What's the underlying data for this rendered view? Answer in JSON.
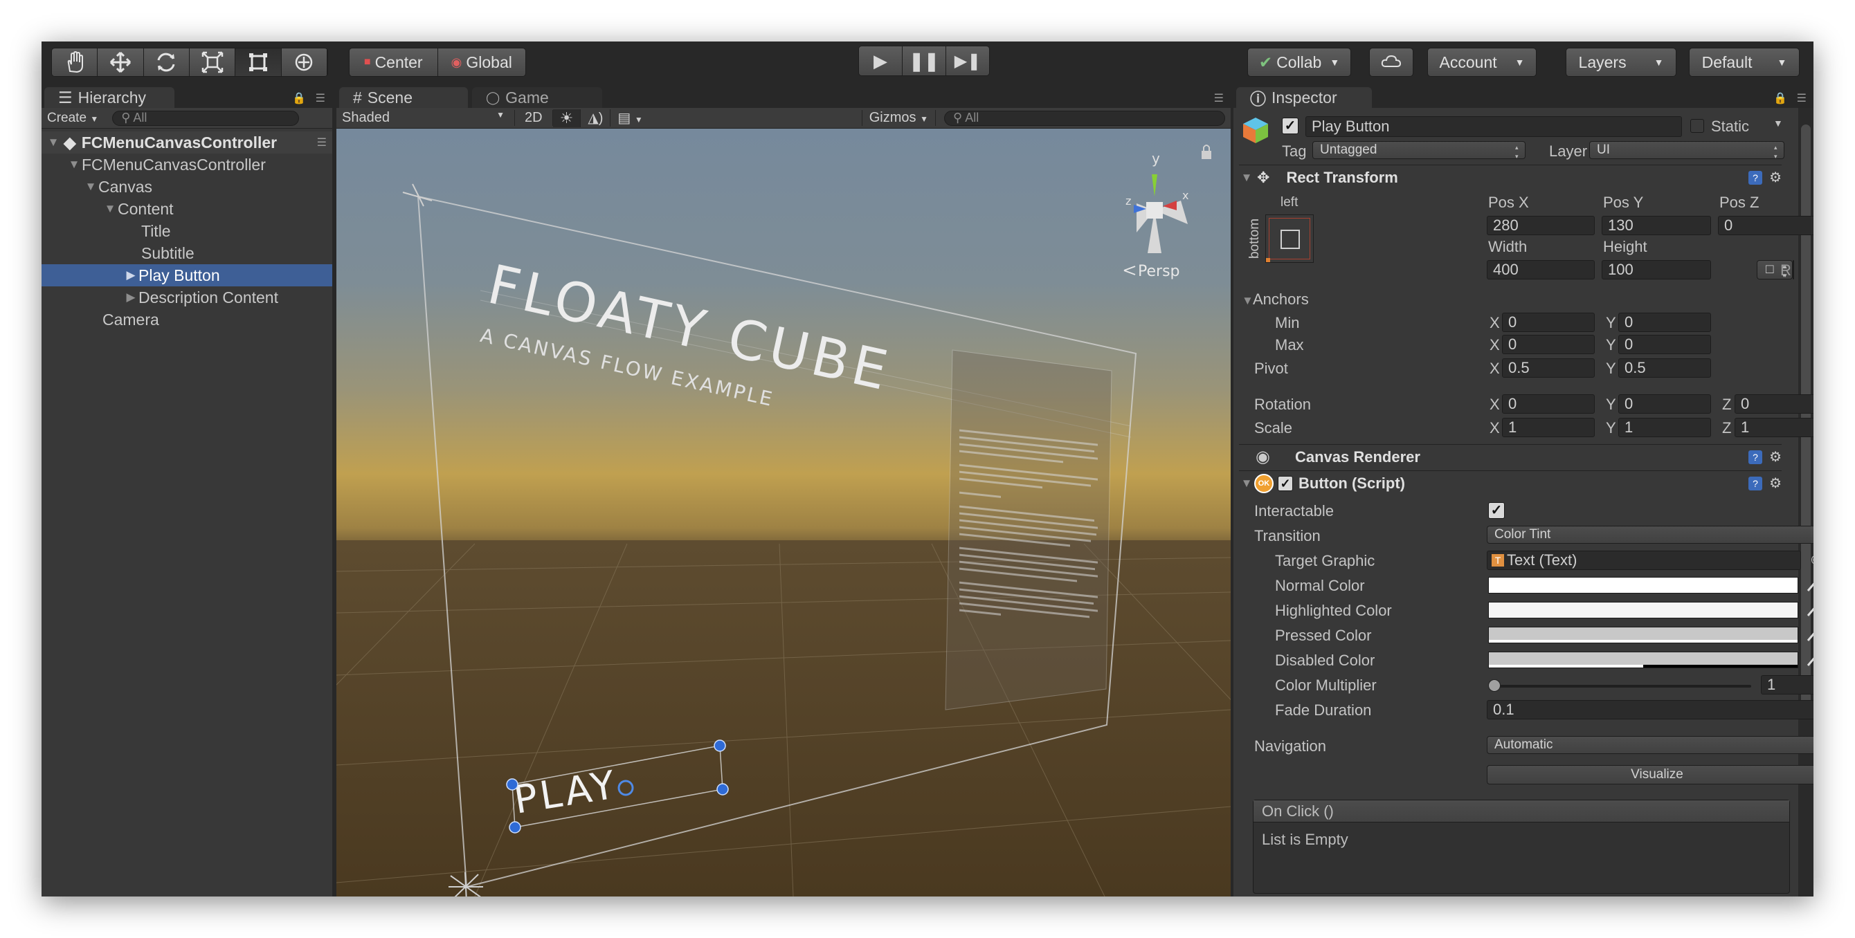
{
  "toolbar": {
    "tools": [
      "hand-icon",
      "move-icon",
      "rotate-icon",
      "scale-icon",
      "rect-tool-icon",
      "transform-tool-icon"
    ],
    "pivot_label": "Center",
    "space_label": "Global",
    "collab_label": "Collab",
    "account_label": "Account",
    "layers_label": "Layers",
    "layout_label": "Default"
  },
  "hierarchy": {
    "tab_label": "Hierarchy",
    "create_label": "Create",
    "search_placeholder": "All",
    "scene_name": "FCMenuCanvasController",
    "items": [
      {
        "label": "FCMenuCanvasController"
      },
      {
        "label": "Canvas"
      },
      {
        "label": "Content"
      },
      {
        "label": "Title"
      },
      {
        "label": "Subtitle"
      },
      {
        "label": "Play Button"
      },
      {
        "label": "Description Content"
      },
      {
        "label": "Camera"
      }
    ]
  },
  "scene_view": {
    "tab_scene": "Scene",
    "tab_game": "Game",
    "shading": "Shaded",
    "mode_2d": "2D",
    "gizmos_label": "Gizmos",
    "search_placeholder": "All",
    "persp_label": "Persp",
    "title_text": "FLOATY CUBE",
    "subtitle_text": "A CANVAS FLOW EXAMPLE",
    "play_text": "PLAY",
    "axis_y": "y",
    "axis_x": "x",
    "axis_z": "z"
  },
  "inspector": {
    "tab_label": "Inspector",
    "object_name": "Play Button",
    "static_label": "Static",
    "tag_label": "Tag",
    "tag_value": "Untagged",
    "layer_label": "Layer",
    "layer_value": "UI",
    "rect_transform": {
      "title": "Rect Transform",
      "anchor_h": "left",
      "anchor_v": "bottom",
      "pos_x_label": "Pos X",
      "pos_x": "280",
      "pos_y_label": "Pos Y",
      "pos_y": "130",
      "pos_z_label": "Pos Z",
      "pos_z": "0",
      "width_label": "Width",
      "width": "400",
      "height_label": "Height",
      "height": "100",
      "r_label": "R",
      "anchors_label": "Anchors",
      "min_label": "Min",
      "min_x": "0",
      "min_y": "0",
      "max_label": "Max",
      "max_x": "0",
      "max_y": "0",
      "pivot_label": "Pivot",
      "pivot_x": "0.5",
      "pivot_y": "0.5",
      "rotation_label": "Rotation",
      "rot_x": "0",
      "rot_y": "0",
      "rot_z": "0",
      "scale_label": "Scale",
      "scale_x": "1",
      "scale_y": "1",
      "scale_z": "1",
      "x": "X",
      "y": "Y",
      "z": "Z"
    },
    "canvas_renderer_title": "Canvas Renderer",
    "button_script": {
      "title": "Button (Script)",
      "ok_badge": "OK",
      "interactable_label": "Interactable",
      "transition_label": "Transition",
      "transition_value": "Color Tint",
      "target_graphic_label": "Target Graphic",
      "target_graphic_value": "Text (Text)",
      "normal_color_label": "Normal Color",
      "normal_color": "#FFFFFF",
      "highlighted_color_label": "Highlighted Color",
      "highlighted_color": "#F5F5F5",
      "pressed_color_label": "Pressed Color",
      "pressed_color": "#C8C8C8",
      "disabled_color_label": "Disabled Color",
      "disabled_color": "#C8C8C8",
      "disabled_alpha_fraction": 0.5,
      "color_multiplier_label": "Color Multiplier",
      "color_multiplier": "1",
      "color_multiplier_fraction": 0.0,
      "fade_duration_label": "Fade Duration",
      "fade_duration": "0.1",
      "navigation_label": "Navigation",
      "navigation_value": "Automatic",
      "visualize_label": "Visualize",
      "on_click_label": "On Click ()",
      "list_empty_label": "List is Empty"
    }
  }
}
